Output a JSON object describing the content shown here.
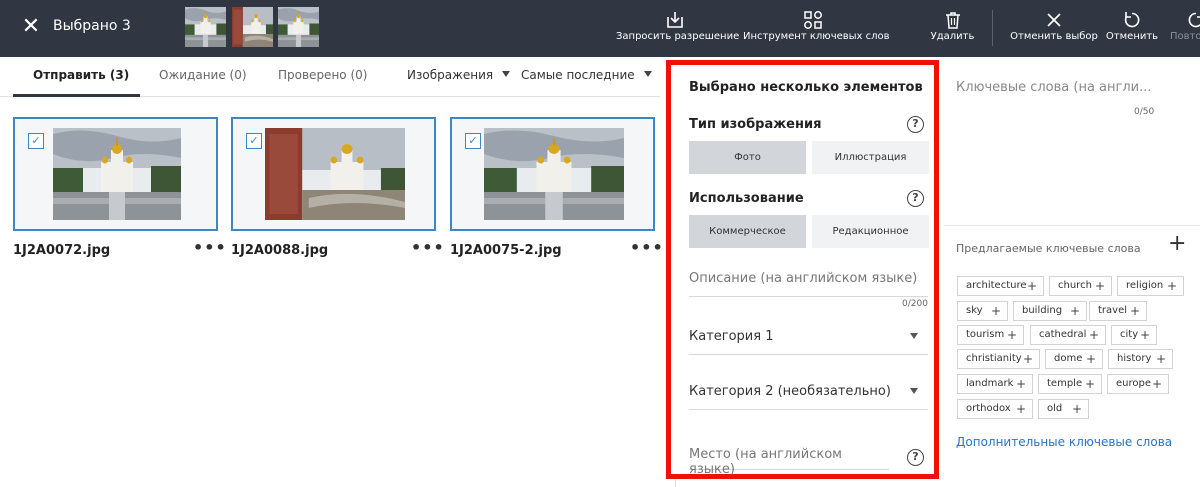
{
  "header": {
    "title": "Выбрано 3",
    "actions": {
      "request": "Запросить разрешение",
      "keywords": "Инструмент ключевых слов",
      "delete": "Удалить",
      "deselect": "Отменить выбор",
      "undo": "Отменить",
      "redo": "Повто"
    }
  },
  "tabs": [
    {
      "label": "Отправить (3)",
      "active": true
    },
    {
      "label": "Ожидание (0)",
      "active": false
    },
    {
      "label": "Проверено (0)",
      "active": false
    }
  ],
  "filters": {
    "type": "Изображения",
    "sort": "Самые последние"
  },
  "files": [
    {
      "name": "1J2A0072.jpg",
      "selected": true
    },
    {
      "name": "1J2A0088.jpg",
      "selected": true
    },
    {
      "name": "1J2A0075-2.jpg",
      "selected": true
    }
  ],
  "panel": {
    "title": "Выбрано несколько элементов",
    "image_type_label": "Тип изображения",
    "image_type_options": [
      "Фото",
      "Иллюстрация"
    ],
    "image_type_selected": "Фото",
    "usage_label": "Использование",
    "usage_options": [
      "Коммерческое",
      "Редакционное"
    ],
    "usage_selected": "Коммерческое",
    "description_placeholder": "Описание (на английском языке)",
    "description_count": "0/200",
    "category1": "Категория 1",
    "category2": "Категория 2 (необязательно)",
    "location_placeholder": "Место (на английском языке)"
  },
  "keywords": {
    "placeholder": "Ключевые слова (на англи...",
    "count": "0/50",
    "suggested_label": "Предлагаемые ключевые слова",
    "suggested": [
      "architecture",
      "church",
      "religion",
      "sky",
      "building",
      "travel",
      "tourism",
      "cathedral",
      "city",
      "christianity",
      "dome",
      "history",
      "landmark",
      "temple",
      "europe",
      "orthodox",
      "old"
    ],
    "more_link": "Дополнительные ключевые слова"
  },
  "colors": {
    "topbar": "#303742",
    "accent": "#3e86c6",
    "highlight_border": "#f0100a",
    "link": "#2c73c3"
  }
}
